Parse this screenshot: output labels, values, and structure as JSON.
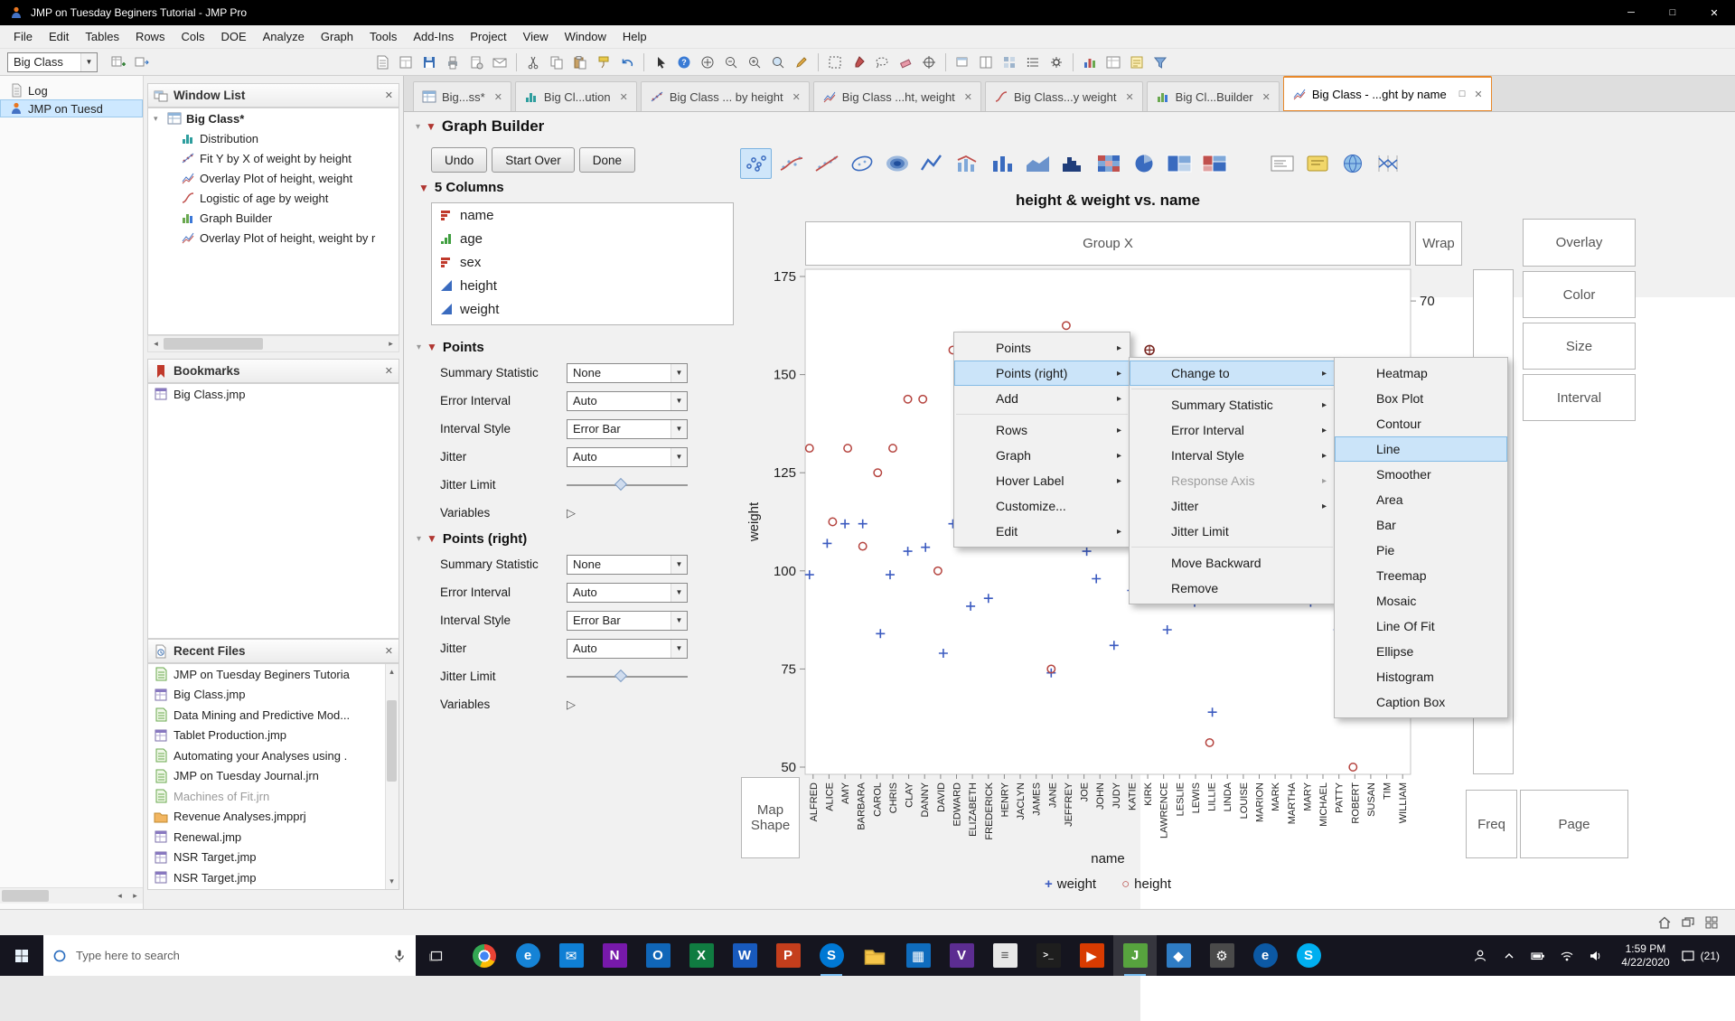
{
  "window": {
    "title": "JMP on Tuesday Beginers Tutorial - JMP Pro"
  },
  "menu_bar": [
    "File",
    "Edit",
    "Tables",
    "Rows",
    "Cols",
    "DOE",
    "Analyze",
    "Graph",
    "Tools",
    "Add-Ins",
    "Project",
    "View",
    "Window",
    "Help"
  ],
  "toolbar": {
    "context_combo": "Big Class",
    "groups": [
      [
        "add-rows",
        "move-table"
      ],
      [
        "journal",
        "layout-page",
        "save",
        "print",
        "page-setup",
        "email"
      ],
      [
        "cut",
        "copy",
        "paste",
        "format-painter",
        "undo"
      ],
      [
        "cursor",
        "help",
        "hand",
        "zoom-out",
        "zoom-in",
        "magnifier",
        "annotate"
      ],
      [
        "selection",
        "brush",
        "lasso",
        "eraser",
        "crosshair"
      ],
      [
        "new-window",
        "split",
        "matrix",
        "list",
        "gear"
      ],
      [
        "chart",
        "table-view",
        "notes",
        "filter"
      ]
    ]
  },
  "left_rail": {
    "items": [
      {
        "label": "Log",
        "icon": "log",
        "selected": false
      },
      {
        "label": "JMP on Tuesd",
        "icon": "jmp-man",
        "selected": true
      }
    ]
  },
  "window_list": {
    "title": "Window List",
    "items": [
      {
        "label": "Big Class*",
        "icon": "data-table",
        "level": 0,
        "bold": true
      },
      {
        "label": "Distribution",
        "icon": "distribution",
        "level": 1
      },
      {
        "label": "Fit Y by X of weight by height",
        "icon": "fit-yx",
        "level": 1
      },
      {
        "label": "Overlay Plot of height, weight",
        "icon": "overlay-plot",
        "level": 1
      },
      {
        "label": "Logistic of age by weight",
        "icon": "logistic",
        "level": 1
      },
      {
        "label": "Graph Builder",
        "icon": "graph-builder",
        "level": 1
      },
      {
        "label": "Overlay Plot of height, weight by r",
        "icon": "overlay-plot",
        "level": 1
      }
    ]
  },
  "bookmarks": {
    "title": "Bookmarks",
    "items": [
      {
        "label": "Big Class.jmp",
        "icon": "jmp-file"
      }
    ]
  },
  "recent_files": {
    "title": "Recent Files",
    "items": [
      {
        "label": "JMP on Tuesday Beginers Tutoria",
        "icon": "journal-file"
      },
      {
        "label": "Big Class.jmp",
        "icon": "jmp-file"
      },
      {
        "label": "Data Mining and Predictive Mod...",
        "icon": "journal-file"
      },
      {
        "label": "Tablet Production.jmp",
        "icon": "jmp-file"
      },
      {
        "label": "Automating your Analyses using .",
        "icon": "journal-file"
      },
      {
        "label": "JMP on Tuesday Journal.jrn",
        "icon": "journal-file"
      },
      {
        "label": "Machines of Fit.jrn",
        "icon": "journal-file",
        "dim": true
      },
      {
        "label": "Revenue Analyses.jmpprj",
        "icon": "project-file"
      },
      {
        "label": "Renewal.jmp",
        "icon": "jmp-file"
      },
      {
        "label": "NSR Target.jmp",
        "icon": "jmp-file"
      },
      {
        "label": "NSR Target.jmp",
        "icon": "jmp-file"
      }
    ]
  },
  "tabs": [
    {
      "label": "Big...ss*",
      "icon": "data-table",
      "close": true
    },
    {
      "label": "Big Cl...ution",
      "icon": "distribution",
      "close": true
    },
    {
      "label": "Big Class ... by height",
      "icon": "fit-yx",
      "close": true
    },
    {
      "label": "Big Class ...ht, weight",
      "icon": "overlay-plot",
      "close": true
    },
    {
      "label": "Big Class...y weight",
      "icon": "logistic",
      "close": true
    },
    {
      "label": "Big Cl...Builder",
      "icon": "graph-builder",
      "close": true
    },
    {
      "label": "Big Class - ...ght by name",
      "icon": "overlay-plot",
      "active": true,
      "restore": true,
      "close": true
    }
  ],
  "graph_builder": {
    "title": "Graph Builder",
    "buttons": [
      "Undo",
      "Start Over",
      "Done"
    ],
    "palette": {
      "group1": [
        "points",
        "smoother",
        "line-of-fit",
        "ellipse",
        "contour",
        "line",
        "bar-line",
        "bar",
        "area",
        "histogram",
        "heatmap",
        "pie",
        "treemap",
        "mosaic"
      ],
      "group2": [
        "caption-box",
        "formula",
        "map-shapes",
        "parallel"
      ],
      "selected": "points"
    },
    "columns_panel": {
      "title": "5 Columns",
      "columns": [
        {
          "name": "name",
          "icon": "nominal"
        },
        {
          "name": "age",
          "icon": "ordinal"
        },
        {
          "name": "sex",
          "icon": "nominal"
        },
        {
          "name": "height",
          "icon": "continuous"
        },
        {
          "name": "weight",
          "icon": "continuous"
        }
      ]
    },
    "points_panel": {
      "title": "Points",
      "fields": [
        {
          "label": "Summary Statistic",
          "type": "select",
          "value": "None"
        },
        {
          "label": "Error Interval",
          "type": "select",
          "value": "Auto"
        },
        {
          "label": "Interval Style",
          "type": "select",
          "value": "Error Bar"
        },
        {
          "label": "Jitter",
          "type": "select",
          "value": "Auto"
        },
        {
          "label": "Jitter Limit",
          "type": "slider",
          "thumb_position": 0.45
        },
        {
          "label": "Variables",
          "type": "expander"
        }
      ]
    },
    "points_right_panel": {
      "title": "Points (right)",
      "fields": [
        {
          "label": "Summary Statistic",
          "type": "select",
          "value": "None"
        },
        {
          "label": "Error Interval",
          "type": "select",
          "value": "Auto"
        },
        {
          "label": "Interval Style",
          "type": "select",
          "value": "Error Bar"
        },
        {
          "label": "Jitter",
          "type": "select",
          "value": "Auto"
        },
        {
          "label": "Jitter Limit",
          "type": "slider",
          "thumb_position": 0.45
        },
        {
          "label": "Variables",
          "type": "expander"
        }
      ]
    },
    "zones": {
      "group_x": "Group X",
      "wrap": "Wrap",
      "overlay": "Overlay",
      "color": "Color",
      "size": "Size",
      "interval": "Interval",
      "freq": "Freq",
      "page": "Page",
      "map_shape": "Map Shape"
    }
  },
  "chart_data": {
    "type": "scatter",
    "title": "height & weight vs. name",
    "xlabel": "name",
    "ylabel": "weight",
    "y2label": "height",
    "ylim": [
      50,
      175
    ],
    "y2lim": [
      51,
      71
    ],
    "yticks": [
      175,
      150,
      125,
      100,
      75,
      50
    ],
    "y2tick_label": "70",
    "grid": false,
    "legend_position": "bottom",
    "series_colors": {
      "weight": "#3c5bc0",
      "height": "#b5443f"
    },
    "legend": [
      {
        "label": "weight",
        "marker": "plus",
        "color": "#3c5bc0"
      },
      {
        "label": "height",
        "marker": "circle",
        "color": "#b5443f"
      }
    ],
    "categories": [
      "ALFRED",
      "ALICE",
      "AMY",
      "BARBARA",
      "CAROL",
      "CHRIS",
      "CLAY",
      "DANNY",
      "DAVID",
      "EDWARD",
      "ELIZABETH",
      "FREDERICK",
      "HENRY",
      "JACLYN",
      "JAMES",
      "JANE",
      "JEFFREY",
      "JOE",
      "JOHN",
      "JUDY",
      "KATIE",
      "KIRK",
      "LAWRENCE",
      "LESLIE",
      "LEWIS",
      "LILLIE",
      "LINDA",
      "LOUISE",
      "MARION",
      "MARK",
      "MARTHA",
      "MARY",
      "MICHAEL",
      "PATTY",
      "ROBERT",
      "SUSAN",
      "TIM",
      "WILLIAM"
    ],
    "rows": [
      [
        "ALFRED",
        64,
        99
      ],
      [
        "ALICE",
        61,
        107
      ],
      [
        "AMY",
        64,
        112
      ],
      [
        "BARBARA",
        60,
        112
      ],
      [
        "CAROL",
        63,
        84
      ],
      [
        "CHRIS",
        64,
        99
      ],
      [
        "CLAY",
        66,
        105
      ],
      [
        "DANNY",
        66,
        106
      ],
      [
        "DAVID",
        59,
        79
      ],
      [
        "EDWARD",
        68,
        112
      ],
      [
        "ELIZABETH",
        62,
        91
      ],
      [
        "FREDERICK",
        63,
        93
      ],
      [
        "HENRY",
        65,
        119
      ],
      [
        "JACLYN",
        66,
        145
      ],
      [
        "JAMES",
        61,
        128
      ],
      [
        "JANE",
        55,
        74
      ],
      [
        "JEFFREY",
        69,
        113
      ],
      [
        "JOE",
        63,
        105
      ],
      [
        "JOHN",
        65,
        98
      ],
      [
        "JUDY",
        61,
        81
      ],
      [
        "KATIE",
        59,
        95
      ],
      [
        "KIRK",
        68,
        134
      ],
      [
        "LAWRENCE",
        62,
        85
      ],
      [
        "LESLIE",
        65,
        142
      ],
      [
        "LEWIS",
        64,
        92
      ],
      [
        "LILLIE",
        52,
        64
      ],
      [
        "LINDA",
        59,
        97
      ],
      [
        "LOUISE",
        61,
        123
      ],
      [
        "MARION",
        60,
        116
      ],
      [
        "MARK",
        62,
        128
      ],
      [
        "MARTHA",
        65,
        112
      ],
      [
        "MARY",
        62,
        92
      ],
      [
        "MICHAEL",
        58,
        95
      ],
      [
        "PATTY",
        62,
        85
      ],
      [
        "ROBERT",
        51,
        79
      ],
      [
        "ROBERT",
        67,
        128
      ],
      [
        "SUSAN",
        56,
        67
      ],
      [
        "TIM",
        60,
        84
      ],
      [
        "WILLIAM",
        65,
        114
      ]
    ],
    "highlighted": {
      "series": "height",
      "name": "KIRK",
      "value": 68
    }
  },
  "context_menus": {
    "menu1": {
      "items": [
        {
          "label": "Points",
          "arrow": true
        },
        {
          "label": "Points (right)",
          "arrow": true,
          "selected": true
        },
        {
          "label": "Add",
          "arrow": true
        },
        {
          "separator": true
        },
        {
          "label": "Rows",
          "arrow": true
        },
        {
          "label": "Graph",
          "arrow": true
        },
        {
          "label": "Hover Label",
          "arrow": true
        },
        {
          "label": "Customize..."
        },
        {
          "label": "Edit",
          "arrow": true
        }
      ]
    },
    "menu2": {
      "items": [
        {
          "label": "Change to",
          "arrow": true,
          "selected": true
        },
        {
          "separator": true
        },
        {
          "label": "Summary Statistic",
          "arrow": true
        },
        {
          "label": "Error Interval",
          "arrow": true
        },
        {
          "label": "Interval Style",
          "arrow": true
        },
        {
          "label": "Response Axis",
          "arrow": true,
          "disabled": true
        },
        {
          "label": "Jitter",
          "arrow": true
        },
        {
          "label": "Jitter Limit"
        },
        {
          "separator": true
        },
        {
          "label": "Move Backward"
        },
        {
          "label": "Remove"
        }
      ]
    },
    "menu3": {
      "items": [
        {
          "label": "Heatmap"
        },
        {
          "label": "Box Plot"
        },
        {
          "label": "Contour"
        },
        {
          "label": "Line",
          "selected": true
        },
        {
          "label": "Smoother"
        },
        {
          "label": "Area"
        },
        {
          "label": "Bar"
        },
        {
          "label": "Pie"
        },
        {
          "label": "Treemap"
        },
        {
          "label": "Mosaic"
        },
        {
          "label": "Line Of Fit"
        },
        {
          "label": "Ellipse"
        },
        {
          "label": "Histogram"
        },
        {
          "label": "Caption Box"
        }
      ]
    }
  },
  "taskbar": {
    "search": {
      "placeholder": "Type here to search"
    },
    "apps": [
      {
        "name": "chrome",
        "kind": "chrome"
      },
      {
        "name": "edge",
        "kind": "tile",
        "bg": "#1583d6",
        "glyph": "e",
        "round": true
      },
      {
        "name": "mail",
        "kind": "tile",
        "bg": "#0f7fd4",
        "glyph": "✉"
      },
      {
        "name": "onenote",
        "kind": "tile",
        "bg": "#7719aa",
        "glyph": "N"
      },
      {
        "name": "outlook",
        "kind": "tile",
        "bg": "#1066b8",
        "glyph": "O"
      },
      {
        "name": "excel",
        "kind": "tile",
        "bg": "#107c41",
        "glyph": "X"
      },
      {
        "name": "word",
        "kind": "tile",
        "bg": "#185abd",
        "glyph": "W"
      },
      {
        "name": "powerpoint",
        "kind": "tile",
        "bg": "#c43e1c",
        "glyph": "P"
      },
      {
        "name": "skype",
        "kind": "tile",
        "bg": "#0078d4",
        "glyph": "S",
        "round": true,
        "open": true
      },
      {
        "name": "file-explorer",
        "kind": "folder"
      },
      {
        "name": "photos",
        "kind": "tile",
        "bg": "#0f6cbd",
        "glyph": "▦"
      },
      {
        "name": "visual-studio",
        "kind": "tile",
        "bg": "#5c2d91",
        "glyph": "V"
      },
      {
        "name": "notepad",
        "kind": "tile",
        "bg": "#e8e8e8",
        "glyph": "≡",
        "fg": "#555"
      },
      {
        "name": "terminal",
        "kind": "tile",
        "bg": "#1e1e1e",
        "glyph": ">_"
      },
      {
        "name": "media-player",
        "kind": "tile",
        "bg": "#d83b01",
        "glyph": "▶"
      },
      {
        "name": "jmp",
        "kind": "tile",
        "bg": "#57a33e",
        "glyph": "J",
        "open": true,
        "active": true
      },
      {
        "name": "paint",
        "kind": "tile",
        "bg": "#2f7cc4",
        "glyph": "◆"
      },
      {
        "name": "settings",
        "kind": "tile",
        "bg": "#4a4a4a",
        "glyph": "⚙"
      },
      {
        "name": "edge-dev",
        "kind": "tile",
        "bg": "#0c59a4",
        "glyph": "e",
        "round": true
      },
      {
        "name": "skype-business",
        "kind": "tile",
        "bg": "#00aff0",
        "glyph": "S",
        "round": true
      }
    ],
    "tray": {
      "icons": [
        "person",
        "chevron-up",
        "battery",
        "network",
        "volume"
      ],
      "time": "1:59 PM",
      "date": "4/22/2020",
      "badge": "(21)"
    }
  }
}
